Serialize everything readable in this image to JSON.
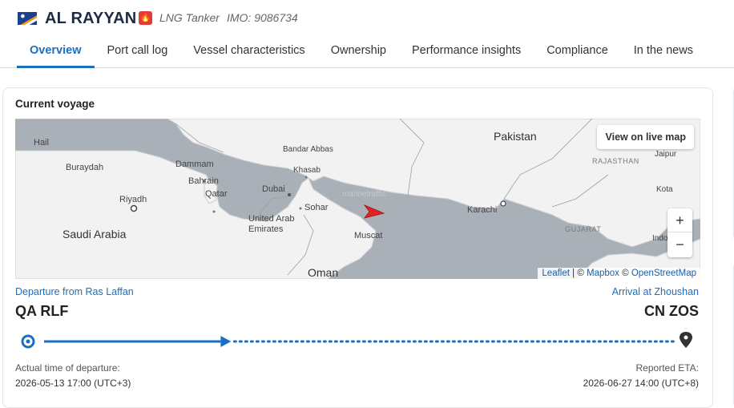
{
  "vessel": {
    "name": "AL RAYYAN",
    "type": "LNG Tanker",
    "imo": "IMO: 9086734",
    "flag_icon": "marshall-islands-flag",
    "type_icon": "flame-icon"
  },
  "tabs": [
    {
      "label": "Overview",
      "active": true
    },
    {
      "label": "Port call log",
      "active": false
    },
    {
      "label": "Vessel characteristics",
      "active": false
    },
    {
      "label": "Ownership",
      "active": false
    },
    {
      "label": "Performance insights",
      "active": false
    },
    {
      "label": "Compliance",
      "active": false
    },
    {
      "label": "In the news",
      "active": false
    }
  ],
  "voyage": {
    "title": "Current voyage",
    "departure_label": "Departure from Ras Laffan",
    "departure_code": "QA RLF",
    "arrival_label": "Arrival at Zhoushan",
    "arrival_code": "CN ZOS",
    "atd_label": "Actual time of departure:",
    "atd_value": "2026-05-13 17:00 (UTC+3)",
    "eta_label": "Reported ETA:",
    "eta_value": "2026-06-27 14:00 (UTC+8)",
    "progress_fraction": 0.28
  },
  "map": {
    "live_button": "View on live map",
    "zoom_in": "+",
    "zoom_out": "−",
    "attribution_leaflet": "Leaflet",
    "attribution_sep1": "| ©",
    "attribution_mapbox": "Mapbox",
    "attribution_sep2": "©",
    "attribution_osm": "OpenStreetMap",
    "watermark": "marinetraffic",
    "labels": {
      "hail": "Hail",
      "buraydah": "Buraydah",
      "riyadh": "Riyadh",
      "saudi_arabia": "Saudi Arabia",
      "dammam": "Dammam",
      "bahrain": "Bahrain",
      "qatar": "Qatar",
      "dubai": "Dubai",
      "uae": "United Arab\nEmirates",
      "sohar": "Sohar",
      "muscat": "Muscat",
      "oman": "Oman",
      "bandar_abbas": "Bandar Abbas",
      "khasab": "Khasab",
      "pakistan": "Pakistan",
      "karachi": "Karachi",
      "rajasthan": "RAJASTHAN",
      "jaipur": "Jaipur",
      "kota": "Kota",
      "gujarat": "GUJARAT",
      "indo": "Indo"
    },
    "colors": {
      "land": "#f2f2f2",
      "sea": "#abb1b8",
      "vessel": "#e02424"
    }
  }
}
